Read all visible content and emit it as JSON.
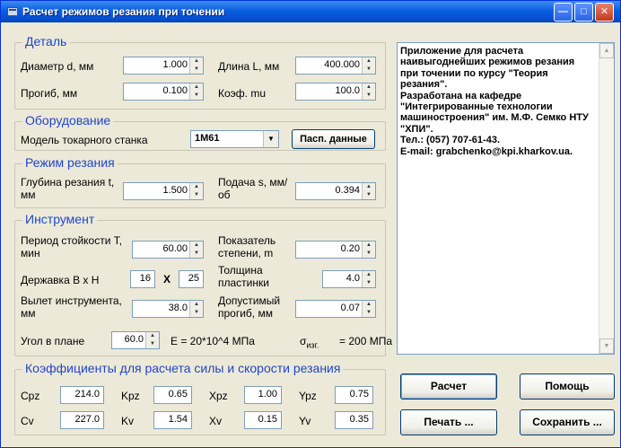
{
  "window": {
    "title": "Расчет режимов резания при точении",
    "minimize": "—",
    "maximize": "□",
    "close": "✕"
  },
  "detail": {
    "title": "Деталь",
    "diameter_label": "Диаметр d, мм",
    "diameter_value": "1.000",
    "length_label": "Длина L, мм",
    "length_value": "400.000",
    "deflection_label": "Прогиб, мм",
    "deflection_value": "0.100",
    "mu_label": "Коэф. mu",
    "mu_value": "100.0"
  },
  "equipment": {
    "title": "Оборудование",
    "model_label": "Модель токарного станка",
    "model_value": "1М61",
    "passport_button": "Пасп. данные"
  },
  "cutting_mode": {
    "title": "Режим резания",
    "depth_label": "Глубина резания t, мм",
    "depth_value": "1.500",
    "feed_label": "Подача s, мм/об",
    "feed_value": "0.394"
  },
  "tool": {
    "title": "Инструмент",
    "life_label": "Период стойкости T, мин",
    "life_value": "60.00",
    "exponent_label": "Показатель степени, m",
    "exponent_value": "0.20",
    "holder_label": "Державка B x H",
    "holder_b": "16",
    "holder_x": "X",
    "holder_h": "25",
    "plate_label": "Толщина пластинки",
    "plate_value": "4.0",
    "overhang_label": "Вылет инструмента, мм",
    "overhang_value": "38.0",
    "allowed_label": "Допустимый прогиб, мм",
    "allowed_value": "0.07",
    "angle_label": "Угол в плане",
    "angle_value": "60.0",
    "modulus_text": "E = 20*10^4 МПа",
    "sigma_symbol": "σ",
    "sigma_sub": "изг.",
    "sigma_value": "= 200 МПа"
  },
  "coefficients": {
    "title": "Коэффициенты для расчета силы и скорости резания",
    "row1": [
      {
        "label": "Cpz",
        "value": "214.0"
      },
      {
        "label": "Kpz",
        "value": "0.65"
      },
      {
        "label": "Xpz",
        "value": "1.00"
      },
      {
        "label": "Ypz",
        "value": "0.75"
      }
    ],
    "row2": [
      {
        "label": "Cv",
        "value": "227.0"
      },
      {
        "label": "Kv",
        "value": "1.54"
      },
      {
        "label": "Xv",
        "value": "0.15"
      },
      {
        "label": "Yv",
        "value": "0.35"
      }
    ]
  },
  "info": {
    "text": "Приложение для расчета\nнаивыгоднейших режимов резания\nпри точении по курсу \"Теория\nрезания\".\nРазработана на кафедре\n\"Интегрированные технологии\nмашиностроения\" им. М.Ф. Семко НТУ\n\"ХПИ\".\nТел.: (057) 707-61-43.\nE-mail: grabchenko@kpi.kharkov.ua."
  },
  "buttons": {
    "calculate": "Расчет",
    "help": "Помощь",
    "print": "Печать ...",
    "save": "Сохранить ..."
  }
}
